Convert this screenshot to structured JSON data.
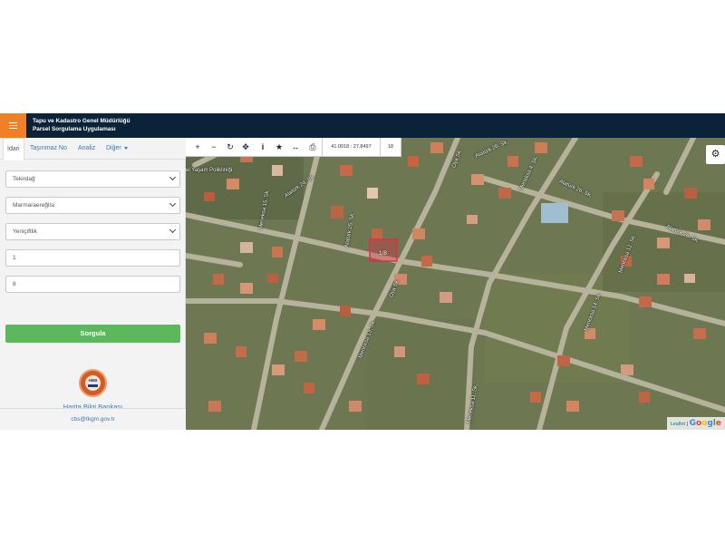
{
  "header": {
    "title_line1": "Tapu ve Kadastro Genel Müdürlüğü",
    "title_line2": "Parsel Sorgulama Uygulaması"
  },
  "tabs": [
    {
      "label": "İdari",
      "active": true
    },
    {
      "label": "Taşınmaz No",
      "active": false
    },
    {
      "label": "Analiz",
      "active": false
    },
    {
      "label": "Diğer",
      "active": false
    }
  ],
  "form": {
    "province": "Tekirdağ",
    "district": "Marmaraereğlisi",
    "neighborhood": "Yeniçiftlik",
    "block": "1",
    "parcel": "8",
    "query_label": "Sorgula"
  },
  "logo": {
    "text": "HBB",
    "caption": "Harita Bilgi Bankası"
  },
  "footer": {
    "email": "cbs@tkgm.gov.tr"
  },
  "map": {
    "coordinates": "41.0018 : 27.8497",
    "zoom_level": "18",
    "parcel_label": "1/8",
    "attribution_leaflet": "Leaflet",
    "attribution_sep": "|",
    "attribution_google": "Google",
    "poi_label": "el Yaşam Polikliniği",
    "streets": [
      "Atatürk 24. Sk.",
      "Atatürk 25. Sk.",
      "Atatürk 26. Sk.",
      "Atatürk 26. Sk.",
      "Atatürk 26. Sk.",
      "Meneksa 15. Sk.",
      "Meneksa 12. Sk.",
      "Meneksa 14. Sk.",
      "Meneksa 13. Sk.",
      "Meneksa 11. Sk.",
      "Meneksa 4. Sk.",
      "Oya Sk.",
      "Oya Sk."
    ]
  },
  "icons": {
    "menu": "hamburger-icon",
    "zoom_in": "plus-icon",
    "zoom_out": "minus-icon",
    "refresh": "refresh-icon",
    "locate": "crosshair-icon",
    "info": "info-icon",
    "favorite": "star-icon",
    "measure": "ruler-icon",
    "print": "print-icon",
    "settings": "gear-icon"
  },
  "colors": {
    "header_bg": "#0b2338",
    "menu_accent": "#f07f28",
    "query_button": "#5cb85c",
    "link": "#337ab7"
  }
}
